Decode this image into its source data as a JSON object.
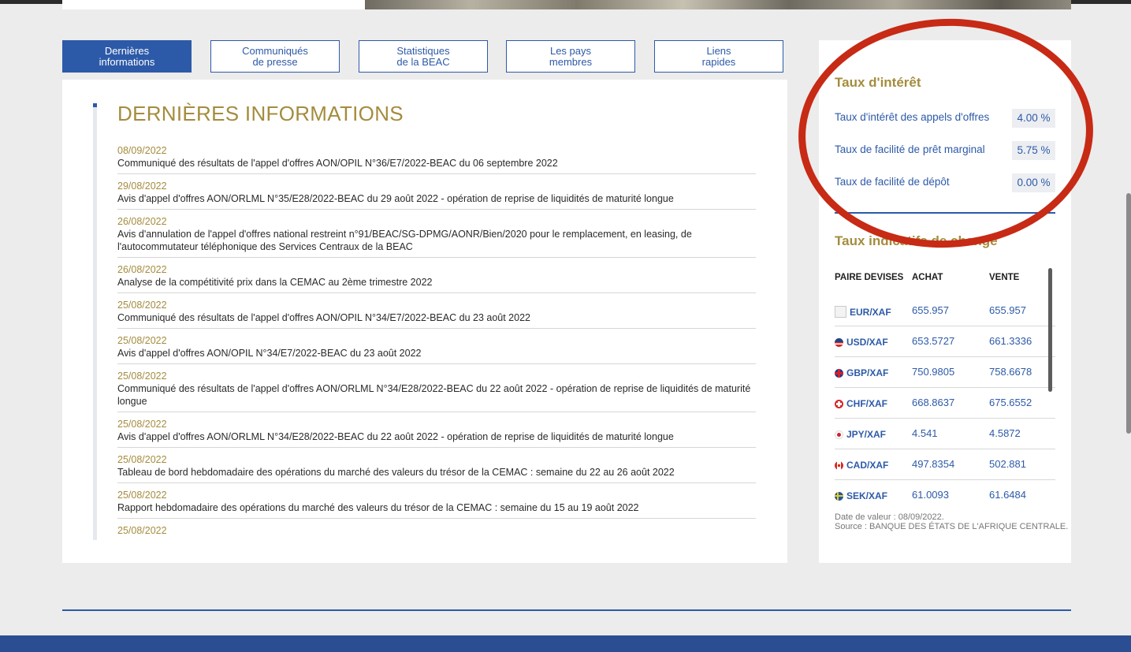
{
  "tabs": [
    {
      "line1": "Dernières",
      "line2": "informations"
    },
    {
      "line1": "Communiqués",
      "line2": "de presse"
    },
    {
      "line1": "Statistiques",
      "line2": "de la BEAC"
    },
    {
      "line1": "Les pays",
      "line2": "membres"
    },
    {
      "line1": "Liens",
      "line2": "rapides"
    }
  ],
  "news": {
    "title": "DERNIÈRES INFORMATIONS",
    "items": [
      {
        "date": "08/09/2022",
        "text": "Communiqué des résultats de l'appel d'offres AON/OPIL N°36/E7/2022-BEAC du 06 septembre 2022"
      },
      {
        "date": "29/08/2022",
        "text": "Avis d'appel d'offres AON/ORLML N°35/E28/2022-BEAC du 29 août 2022 - opération de reprise de liquidités de maturité longue"
      },
      {
        "date": "26/08/2022",
        "text": "Avis d'annulation de l'appel d'offres national restreint n°91/BEAC/SG-DPMG/AONR/Bien/2020 pour le remplacement, en leasing, de l'autocommutateur téléphonique des Services Centraux de la BEAC"
      },
      {
        "date": "26/08/2022",
        "text": "Analyse de la compétitivité prix dans la CEMAC au 2ème trimestre 2022"
      },
      {
        "date": "25/08/2022",
        "text": "Communiqué des résultats de l'appel d'offres AON/OPIL N°34/E7/2022-BEAC du 23 août 2022"
      },
      {
        "date": "25/08/2022",
        "text": "Avis d'appel d'offres AON/OPIL N°34/E7/2022-BEAC du 23 août 2022"
      },
      {
        "date": "25/08/2022",
        "text": "Communiqué des résultats de l'appel d'offres AON/ORLML N°34/E28/2022-BEAC du 22 août 2022 - opération de reprise de liquidités de maturité longue"
      },
      {
        "date": "25/08/2022",
        "text": "Avis d'appel d'offres AON/ORLML N°34/E28/2022-BEAC du 22 août 2022 - opération de reprise de liquidités de maturité longue"
      },
      {
        "date": "25/08/2022",
        "text": "Tableau de bord hebdomadaire des opérations du marché des valeurs du trésor de la CEMAC : semaine du 22 au 26 août 2022"
      },
      {
        "date": "25/08/2022",
        "text": "Rapport hebdomadaire des opérations du marché des valeurs du trésor de la CEMAC : semaine du 15 au 19 août 2022"
      },
      {
        "date": "25/08/2022",
        "text": ""
      }
    ]
  },
  "interest": {
    "heading": "Taux d'intérêt",
    "rates": [
      {
        "label": "Taux d'intérêt des appels d'offres",
        "value": "4.00 %"
      },
      {
        "label": "Taux de facilité de prêt marginal",
        "value": "5.75 %"
      },
      {
        "label": "Taux de facilité de dépôt",
        "value": "0.00 %"
      }
    ]
  },
  "fx": {
    "heading": "Taux indicatifs de change",
    "col_pair": "PAIRE DEVISES",
    "col_buy": "ACHAT",
    "col_sell": "VENTE",
    "rows": [
      {
        "pair": "EUR/XAF",
        "buy": "655.957",
        "sell": "655.957",
        "icon": "eu-flag-icon"
      },
      {
        "pair": "USD/XAF",
        "buy": "653.5727",
        "sell": "661.3336",
        "icon": "us-flag-icon"
      },
      {
        "pair": "GBP/XAF",
        "buy": "750.9805",
        "sell": "758.6678",
        "icon": "gb-flag-icon"
      },
      {
        "pair": "CHF/XAF",
        "buy": "668.8637",
        "sell": "675.6552",
        "icon": "ch-flag-icon"
      },
      {
        "pair": "JPY/XAF",
        "buy": "4.541",
        "sell": "4.5872",
        "icon": "jp-flag-icon"
      },
      {
        "pair": "CAD/XAF",
        "buy": "497.8354",
        "sell": "502.881",
        "icon": "ca-flag-icon"
      },
      {
        "pair": "SEK/XAF",
        "buy": "61.0093",
        "sell": "61.6484",
        "icon": "se-flag-icon"
      }
    ],
    "value_date": "Date de valeur : 08/09/2022.",
    "source": "Source : BANQUE DES ÉTATS DE L'AFRIQUE CENTRALE."
  },
  "colors": {
    "brand_blue": "#2d5aa8",
    "gold": "#a48c3e",
    "highlight_red": "#c72a15"
  }
}
